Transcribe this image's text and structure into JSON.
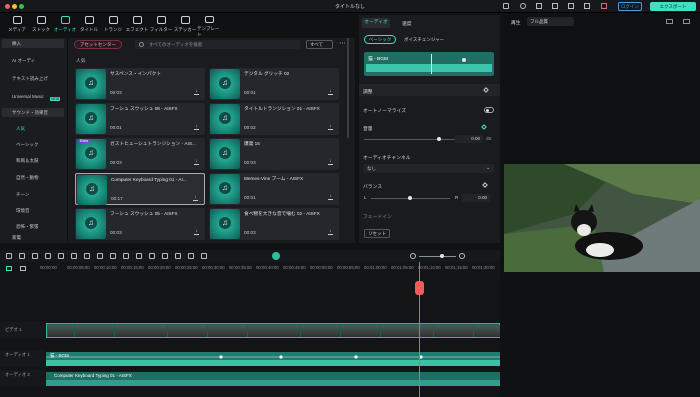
{
  "window": {
    "title": "タイトルなし"
  },
  "topbar": {
    "login_label": "ログイン",
    "export_label": "エクスポート",
    "export_icon": "share-icon"
  },
  "toolbar": [
    {
      "label": "メディア",
      "icon": "media-icon"
    },
    {
      "label": "ストック",
      "icon": "stock-icon"
    },
    {
      "label": "オーディオ",
      "icon": "music-note-icon",
      "active": true
    },
    {
      "label": "タイトル",
      "icon": "title-icon"
    },
    {
      "label": "トランジ",
      "icon": "transition-icon"
    },
    {
      "label": "エフェクト",
      "icon": "effect-icon"
    },
    {
      "label": "フィルター",
      "icon": "filter-icon"
    },
    {
      "label": "ステッカー",
      "icon": "sticker-icon"
    },
    {
      "label": "テンプレート",
      "icon": "template-icon"
    }
  ],
  "sidebar": {
    "items": [
      "挿入",
      "AI オーディ",
      "テキスト読み上げ",
      "Universal Music",
      "サウンド・効果音",
      "人気",
      "ベーシック",
      "和風＆太鼓",
      "自然・動物",
      "チーン",
      "環境音",
      "恐怖・緊張",
      "家電"
    ],
    "new_badge": "NEW"
  },
  "asset_panel": {
    "preset_center": "アセットセンター",
    "search_placeholder": "すべてのオーディオを検索",
    "filter_all": "すべて",
    "section_label": "人気"
  },
  "cards": [
    {
      "title": "サスペンス・インパクト",
      "duration": "00:03"
    },
    {
      "title": "デジタル グリッチ 02",
      "duration": "00:01"
    },
    {
      "title": "フーシュ スウッシュ 08 - AISFX",
      "duration": "00:01"
    },
    {
      "title": "タイトルトランジション 01 - AISFX",
      "duration": "00:02"
    },
    {
      "title": "ガストヒューシュトランジション - AIS...",
      "duration": "00:03",
      "badge": "Extra"
    },
    {
      "title": "爆発 16",
      "duration": "00:03"
    },
    {
      "title": "Computer Keyboard Typing 01 - AI...",
      "duration": "00:17",
      "selected": true
    },
    {
      "title": "Memes-Vine ブーム - AISFX",
      "duration": "00:01"
    },
    {
      "title": "フーシュ スウッシュ 05 - AISFX",
      "duration": "00:03"
    },
    {
      "title": "食べ物を大きな音で噛む 02 - AISFX",
      "duration": "00:03"
    }
  ],
  "props": {
    "tabs": [
      "オーディオ",
      "速度"
    ],
    "subtabs": [
      "ベーシック",
      "ボイスチェンジャー"
    ],
    "clip_name": "猫 - BGM",
    "adjust": "調整",
    "auto_normalize": "オートノーマライズ",
    "volume": "音量",
    "volume_value": "0.00",
    "volume_unit": "dB",
    "channel": "オーディオチャンネル",
    "channel_value": "なし",
    "balance": "バランス",
    "balance_left": "L",
    "balance_right": "R",
    "balance_value": "0.00",
    "fade_in": "フェードイン",
    "reset": "リセット"
  },
  "preview": {
    "label": "再生",
    "quality": "フル品質"
  },
  "ruler": [
    "00:00:00",
    "00:00:05:00",
    "00:00:10:00",
    "00:00:15:00",
    "00:00:20:00",
    "00:00:25:00",
    "00:00:30:00",
    "00:00:35:00",
    "00:00:40:00",
    "00:00:45:00",
    "00:00:50:00",
    "00:00:55:00",
    "00:01:00:00",
    "00:01:05:00",
    "00:01:10:00",
    "00:01:15:00",
    "00:01:20:00"
  ],
  "tracks": {
    "video_label": "ビデオ 1",
    "audio1_label": "オーディオ 1",
    "audio2_label": "オーディオ 2",
    "audio1_clip": "猫 - BGM",
    "audio2_clip": "Computer Keyboard Typing 01 - AISFX"
  }
}
